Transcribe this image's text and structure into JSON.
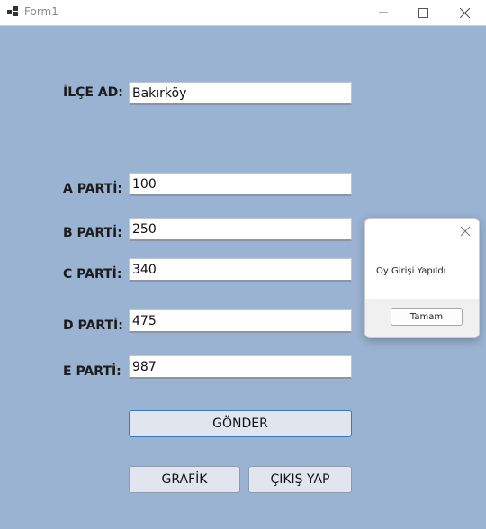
{
  "window": {
    "title": "Form1"
  },
  "form": {
    "ilce_label": "İLÇE AD:",
    "ilce_value": "Bakırköy",
    "parties": [
      {
        "label": "A PARTİ:",
        "value": "100"
      },
      {
        "label": "B PARTİ:",
        "value": "250"
      },
      {
        "label": "C PARTİ:",
        "value": "340"
      },
      {
        "label": "D PARTİ:",
        "value": "475"
      },
      {
        "label": "E PARTİ:",
        "value": "987"
      }
    ],
    "gonder_label": "GÖNDER",
    "grafik_label": "GRAFİK",
    "cikis_label": "ÇIKIŞ YAP"
  },
  "dialog": {
    "message": "Oy Girişi Yapıldı",
    "ok_label": "Tamam"
  },
  "icons": {
    "app": "app-icon",
    "minimize": "minimize-icon",
    "maximize": "maximize-icon",
    "close": "close-icon",
    "dialog_close": "dialog-close-icon"
  },
  "colors": {
    "form_background": "#9ab3d2",
    "button_background": "#e1e6ee",
    "primary_button_border": "#3b78c4"
  }
}
